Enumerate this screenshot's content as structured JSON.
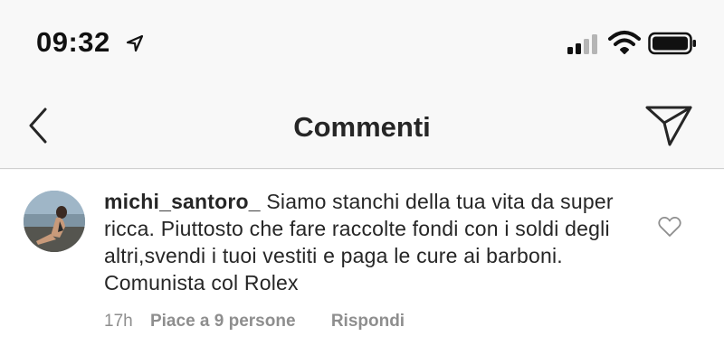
{
  "status_bar": {
    "time": "09:32",
    "location_icon": "location-arrow-icon",
    "signal_icon": "cellular-signal-icon",
    "wifi_icon": "wifi-icon",
    "battery_icon": "battery-icon"
  },
  "nav": {
    "back_icon": "chevron-left-icon",
    "title": "Commenti",
    "send_icon": "paper-plane-icon"
  },
  "comment": {
    "avatar": "user-avatar",
    "username": "michi_santoro_",
    "text": "Siamo stanchi della tua vita da super ricca. Piuttosto che fare raccolte fondi con i soldi degli altri,svendi i tuoi vestiti e paga le cure ai barboni. Comunista col Rolex",
    "timestamp": "17h",
    "likes_label": "Piace a 9 persone",
    "reply_label": "Rispondi",
    "like_icon": "heart-outline-icon"
  },
  "colors": {
    "background": "#f8f8f8",
    "content_bg": "#ffffff",
    "text_primary": "#262626",
    "text_secondary": "#8e8e8e",
    "divider": "#d0d0d0"
  }
}
